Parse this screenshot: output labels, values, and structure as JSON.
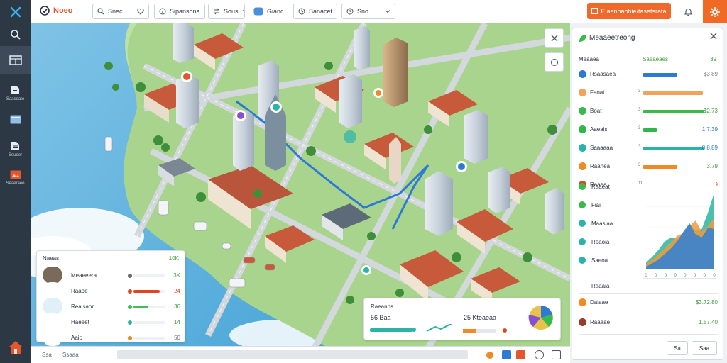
{
  "app": {
    "brand": "Noeo",
    "toolbar": {
      "btn1": "Snec",
      "btn2": "Sipansona",
      "btn3": "Sous",
      "btn4": "Gianc",
      "btn5": "Sanacet",
      "btn6": "Sno",
      "primary": "Eiaenhaohie/tasetsrata"
    }
  },
  "rail": [
    {
      "icon": "close-x-icon",
      "label": ""
    },
    {
      "icon": "search-icon",
      "label": ""
    },
    {
      "icon": "layout-icon",
      "label": ""
    },
    {
      "icon": "file-icon",
      "label": "Saaseate"
    },
    {
      "icon": "card-icon",
      "label": ""
    },
    {
      "icon": "doc-icon",
      "label": "Soueer"
    },
    {
      "icon": "image-icon",
      "label": "Seaeraeo"
    },
    {
      "icon": "home-icon",
      "label": ""
    }
  ],
  "legend": {
    "title": "Naeas",
    "value_header": "10K",
    "rows": [
      {
        "name": "Meaeeera",
        "value": "3K",
        "color": "#6a6a6a",
        "fill": 0.0,
        "value_color": "#3f9b3a"
      },
      {
        "name": "Raaoe",
        "value": "24",
        "color": "#e0451f",
        "fill": 0.85,
        "value_color": "#e0451f"
      },
      {
        "name": "Reaisaor",
        "value": "36",
        "color": "#3fbf5a",
        "fill": 0.45,
        "value_color": "#3f9b3a"
      },
      {
        "name": "Haeeet",
        "value": "14",
        "color": "#2ab4a9",
        "fill": 0.0,
        "value_color": "#3f9b3a"
      },
      {
        "name": "Aaio",
        "value": "50",
        "color": "#f08a24",
        "fill": 0.0,
        "value_color": "#6b7680"
      }
    ]
  },
  "mini_panel": {
    "title": "Raeanns",
    "left": "56  Baa",
    "right": "25  Kteaeaa"
  },
  "bottom": {
    "a": "Ssa",
    "b": "Ssaaa"
  },
  "panel": {
    "title": "Meaaeetreong",
    "head_left": "Meaaea",
    "head_mid": "Saeaeaes",
    "head_right": "39",
    "rows": [
      {
        "label": "Rsaasaea",
        "num": "",
        "value": "$3 89",
        "color": "#2d79d6",
        "fill": 0.5,
        "value_color": "#6b7680"
      },
      {
        "label": "Faoat",
        "num": "3",
        "value": "",
        "color": "#f2a35b",
        "fill": 0.88,
        "value_color": "#3f9b3a"
      },
      {
        "label": "Boat",
        "num": "3",
        "value": "$2.73",
        "color": "#3aba4e",
        "fill": 0.9,
        "value_color": "#3f9b3a"
      },
      {
        "label": "Aaeais",
        "num": "3",
        "value": "1.7.39",
        "color": "#2fb84a",
        "fill": 0.2,
        "value_color": "#2d79d6"
      },
      {
        "label": "Saaaaaa",
        "num": "3",
        "value": "8.8.89",
        "color": "#2ab4a9",
        "fill": 0.9,
        "value_color": "#2d79d6"
      },
      {
        "label": "Raanea",
        "num": "3",
        "value": "3.79",
        "color": "#f08a24",
        "fill": 0.5,
        "value_color": "#3f9b3a"
      },
      {
        "label": "Raaea",
        "num": "119",
        "value": "8.3.9",
        "color": "#e0451f",
        "fill": 0.0,
        "value_color": "#e0451f"
      }
    ],
    "group": [
      {
        "label": "Raaeat",
        "color": "#3aba4e"
      },
      {
        "label": "Fiai",
        "color": "#3aba4e"
      },
      {
        "label": "Maasiaa",
        "color": "#2ab4a9"
      },
      {
        "label": "Reaoia",
        "color": "#2ab4a9"
      },
      {
        "label": "Saeoa",
        "color": "#2ab4a9"
      }
    ],
    "extra_label": "Raaaia",
    "footer_rows": [
      {
        "label": "Daiaae",
        "value": "$3.72.80",
        "color": "#f08a24",
        "value_color": "#3f9b3a"
      },
      {
        "label": "Raaaae",
        "value": "1.57.40",
        "color": "#9a3b2c",
        "value_color": "#3f9b3a"
      }
    ],
    "btn_left": "Sa",
    "btn_right": "Saa"
  },
  "chart_data": {
    "type": "area",
    "x": [
      0,
      1,
      2,
      3,
      4,
      5,
      6,
      7,
      8,
      9,
      10,
      11
    ],
    "series": [
      {
        "values": [
          10,
          18,
          28,
          40,
          46,
          44,
          50,
          66,
          56,
          58,
          82,
          110
        ],
        "color": "#2bb5a0"
      },
      {
        "values": [
          8,
          14,
          22,
          30,
          38,
          48,
          52,
          62,
          70,
          54,
          62,
          74
        ],
        "color": "#f29a3a"
      },
      {
        "values": [
          4,
          9,
          14,
          22,
          30,
          40,
          54,
          66,
          50,
          46,
          60,
          58
        ],
        "color": "#2f7fd8"
      }
    ],
    "ylim": [
      0,
      120
    ],
    "xticks": [
      "0",
      "0",
      "0",
      "0",
      "0",
      "0",
      "0",
      "0"
    ]
  },
  "colors": {
    "accent": "#ef6a2a",
    "rail": "#2d3845",
    "green": "#3f9b3a"
  }
}
